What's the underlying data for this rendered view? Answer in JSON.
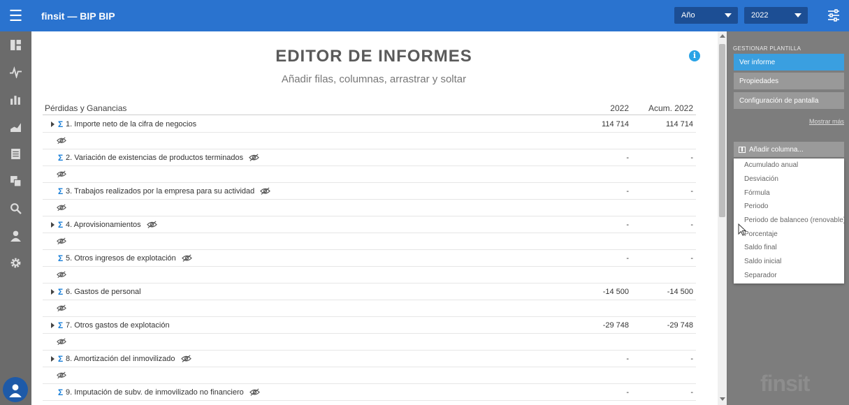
{
  "app": {
    "title": "finsit — BIP BIP"
  },
  "filters": {
    "period_label": "Año",
    "year_label": "2022"
  },
  "report": {
    "title": "EDITOR DE INFORMES",
    "subtitle": "Añadir filas, columnas, arrastrar y soltar",
    "section": "Pérdidas y Ganancias",
    "col1": "2022",
    "col2": "Acum. 2022",
    "rows": [
      {
        "label": "1. Importe neto de la cifra de negocios",
        "v1": "114 714",
        "v2": "114 714",
        "expand": true,
        "hidden": false
      },
      {
        "label": "2. Variación de existencias de productos terminados",
        "v1": "-",
        "v2": "-",
        "expand": false,
        "hidden": true
      },
      {
        "label": "3. Trabajos realizados por la empresa para su actividad",
        "v1": "-",
        "v2": "-",
        "expand": false,
        "hidden": true
      },
      {
        "label": "4. Aprovisionamientos",
        "v1": "-",
        "v2": "-",
        "expand": true,
        "hidden": true
      },
      {
        "label": "5. Otros ingresos de explotación",
        "v1": "-",
        "v2": "-",
        "expand": false,
        "hidden": true
      },
      {
        "label": "6. Gastos de personal",
        "v1": "-14 500",
        "v2": "-14 500",
        "expand": true,
        "hidden": false
      },
      {
        "label": "7. Otros gastos de explotación",
        "v1": "-29 748",
        "v2": "-29 748",
        "expand": true,
        "hidden": false
      },
      {
        "label": "8. Amortización del inmovilizado",
        "v1": "-",
        "v2": "-",
        "expand": true,
        "hidden": true
      },
      {
        "label": "9. Imputación de subv. de inmovilizado no financiero",
        "v1": "-",
        "v2": "-",
        "expand": false,
        "hidden": true
      }
    ]
  },
  "panel": {
    "heading": "GESTIONAR PLANTILLA",
    "buttons": [
      "Ver informe",
      "Propiedades",
      "Configuración de pantalla"
    ],
    "more": "Mostrar más",
    "add_column": "Añadir columna...",
    "options": [
      "Acumulado anual",
      "Desviación",
      "Fórmula",
      "Periodo",
      "Periodo de balanceo (renovable)",
      "Porcentaje",
      "Saldo final",
      "Saldo inicial",
      "Separador"
    ]
  },
  "watermark": "finsit",
  "colors": {
    "topbar": "#2a73cf",
    "accent": "#3a9fe0",
    "sigma": "#1a7fd8"
  },
  "icons": [
    "menu-icon",
    "dashboard-icon",
    "pulse-icon",
    "bar-chart-icon",
    "area-chart-icon",
    "document-icon",
    "copy-icon",
    "search-icon",
    "user-icon",
    "gear-icon",
    "settings-sliders-icon",
    "info-icon",
    "eye-off-icon",
    "sigma-icon"
  ]
}
